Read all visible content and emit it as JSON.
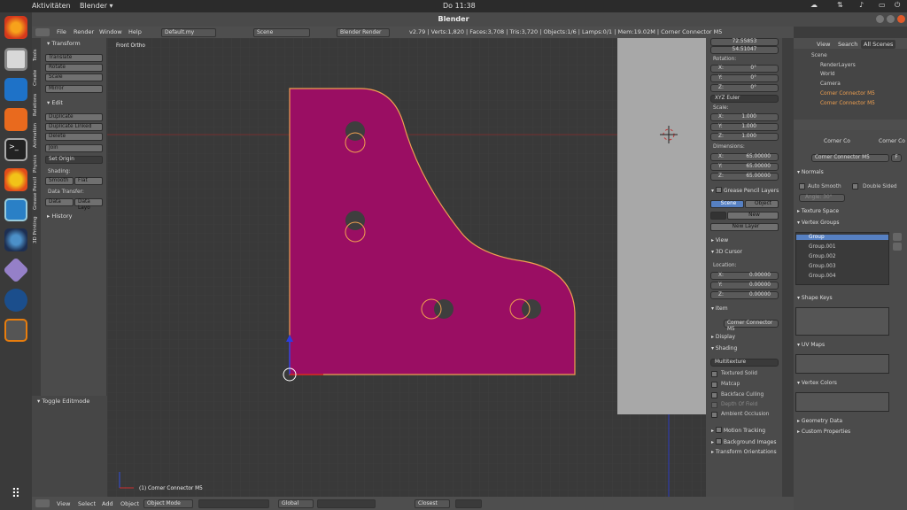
{
  "system": {
    "activities": "Aktivitäten",
    "app_menu": "Blender ▾",
    "clock": "Do 11:38"
  },
  "window": {
    "title": "Blender"
  },
  "menu": {
    "file": "File",
    "render": "Render",
    "window": "Window",
    "help": "Help",
    "layout": "Default.my",
    "scene": "Scene",
    "engine": "Blender Render",
    "stats": "v2.79 | Verts:1,820 | Faces:3,708 | Tris:3,720 | Objects:1/6 | Lamps:0/1 | Mem:19.02M | Corner Connector M5"
  },
  "tool_tabs": [
    "Tools",
    "Create",
    "Relations",
    "Animation",
    "Physics",
    "Grease Pencil",
    "3D Printing"
  ],
  "toolshelf": {
    "transform_hdr": "Transform",
    "translate": "Translate",
    "rotate": "Rotate",
    "scale": "Scale",
    "mirror": "Mirror",
    "edit_hdr": "Edit",
    "duplicate": "Duplicate",
    "duplicate_linked": "Duplicate Linked",
    "delete": "Delete",
    "join": "Join",
    "set_origin": "Set Origin",
    "shading_lbl": "Shading:",
    "smooth": "Smooth",
    "flat": "Flat",
    "data_transfer_lbl": "Data Transfer:",
    "data": "Data",
    "data_layout": "Data Layo",
    "history_hdr": "History",
    "toggle_editmode": "Toggle Editmode"
  },
  "viewport": {
    "view_name": "Front Ortho",
    "object_label": "(1) Corner Connector M5",
    "colors": {
      "object": "#9a0e63",
      "outline": "#f0a050",
      "backdrop": "#a8a8a8"
    }
  },
  "npanel": {
    "loc_z": "72.55853",
    "loc_z2": "54.51047",
    "rotation_lbl": "Rotation:",
    "rot": [
      {
        "k": "X:",
        "v": "0°"
      },
      {
        "k": "Y:",
        "v": "0°"
      },
      {
        "k": "Z:",
        "v": "0°"
      }
    ],
    "euler": "XYZ Euler",
    "scale_lbl": "Scale:",
    "scl": [
      {
        "k": "X:",
        "v": "1.000"
      },
      {
        "k": "Y:",
        "v": "1.000"
      },
      {
        "k": "Z:",
        "v": "1.000"
      }
    ],
    "dimensions_lbl": "Dimensions:",
    "dim": [
      {
        "k": "X:",
        "v": "65.00000"
      },
      {
        "k": "Y:",
        "v": "65.00000"
      },
      {
        "k": "Z:",
        "v": "65.00000"
      }
    ],
    "gp_layers": "Grease Pencil Layers",
    "scene_btn": "Scene",
    "object_btn": "Object",
    "new_btn": "New",
    "new_layer": "New Layer",
    "view_hdr": "View",
    "cursor_hdr": "3D Cursor",
    "location_lbl": "Location:",
    "cur": [
      {
        "k": "X:",
        "v": "0.00000"
      },
      {
        "k": "Y:",
        "v": "0.00000"
      },
      {
        "k": "Z:",
        "v": "0.00000"
      }
    ],
    "item_hdr": "Item",
    "item_name": "Corner Connector M5",
    "display_hdr": "Display",
    "shading_hdr": "Shading",
    "multitexture": "Multitexture",
    "textured_solid": "Textured Solid",
    "matcap": "Matcap",
    "backface": "Backface Culling",
    "depth_of_field": "Depth Of Field",
    "ambient": "Ambient Occlusion",
    "motion_tracking": "Motion Tracking",
    "background_images": "Background Images",
    "transform_orient": "Transform Orientations"
  },
  "outliner": {
    "view": "View",
    "search": "Search",
    "all_scenes": "All Scenes",
    "items": [
      "Scene",
      "RenderLayers",
      "World",
      "Camera",
      "Corner Connector M5",
      "Corner Connector M5"
    ]
  },
  "properties": {
    "crumb1": "Corner Co",
    "crumb2": "Corner Co",
    "mesh_name": "Corner Connector M5",
    "fake": "F",
    "normals_hdr": "Normals",
    "auto_smooth": "Auto Smooth",
    "double_sided": "Double Sided",
    "angle": "Angle:",
    "angle_val": "30°",
    "texture_space": "Texture Space",
    "vertex_groups": "Vertex Groups",
    "groups": [
      "Group",
      "Group.001",
      "Group.002",
      "Group.003",
      "Group.004"
    ],
    "shape_keys": "Shape Keys",
    "uv_maps": "UV Maps",
    "vertex_colors": "Vertex Colors",
    "geometry_data": "Geometry Data",
    "custom_props": "Custom Properties"
  },
  "bottom": {
    "view": "View",
    "select": "Select",
    "add": "Add",
    "object": "Object",
    "mode": "Object Mode",
    "orientation": "Global",
    "snap": "Closest"
  }
}
